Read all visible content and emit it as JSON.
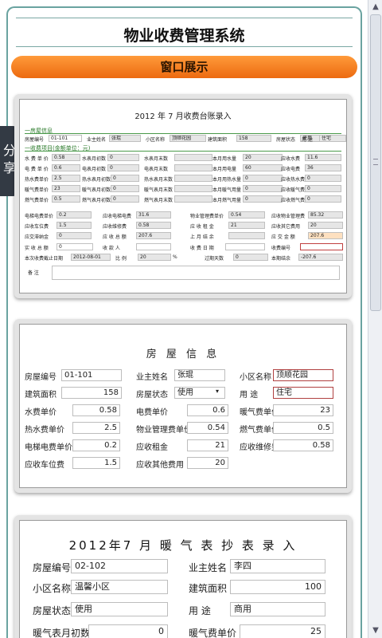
{
  "page_title": "物业收费管理系统",
  "section_bar": "窗口展示",
  "share_label": "分享",
  "card1": {
    "title": "2012  年  7  月收费台账录入",
    "section_house": "一房屋信息",
    "section_fee": "一收费项目(金额单位：元)",
    "house_no_label": "房屋编号",
    "house_no": "01-101",
    "owner_label": "业主姓名",
    "owner": "张琨",
    "area_name_label": "小区名称",
    "area_name": "顶顺花园",
    "building_area_label": "建筑面积",
    "building_area": "158",
    "house_state_label": "房屋状态",
    "house_state": "使用",
    "use_label": "用 途",
    "use": "住宅",
    "water_price_label": "水 费 单 价",
    "water_price": "0.58",
    "water_start_label": "水表月初数",
    "water_start": "0",
    "water_end_label": "水表月末数",
    "water_end": "",
    "water_used_label": "本月用水量",
    "water_used": "20",
    "water_due_label": "应收水费",
    "water_due": "11.6",
    "elec_price_label": "电 费 单 价",
    "elec_price": "0.6",
    "elec_start_label": "电表月初数",
    "elec_start": "0",
    "elec_end_label": "电表月末数",
    "elec_end": "",
    "elec_used_label": "本月用电量",
    "elec_used": "60",
    "elec_due_label": "应收电费",
    "elec_due": "36",
    "hotwater_price_label": "热水费单价",
    "hotwater_price": "2.5",
    "hotwater_start_label": "热水表月初数",
    "hotwater_start": "0",
    "hotwater_end_label": "热水表月末数",
    "hotwater_end": "",
    "hotwater_used_label": "本月用热水量",
    "hotwater_used": "0",
    "hotwater_due_label": "应收热水费",
    "hotwater_due": "0",
    "heat_price_label": "暖气费单价",
    "heat_price": "23",
    "heat_start_label": "暖气表月初数",
    "heat_start": "0",
    "heat_end_label": "暖气表月末数",
    "heat_end": "",
    "heat_used_label": "本月暖气用量",
    "heat_used": "0",
    "heat_due_label": "应收暖气费",
    "heat_due": "0",
    "gas_price_label": "燃气费单价",
    "gas_price": "0.5",
    "gas_start_label": "燃气表月初数",
    "gas_start": "0",
    "gas_end_label": "燃气表月末数",
    "gas_end": "",
    "gas_used_label": "本月燃气用量",
    "gas_used": "0",
    "gas_due_label": "应收燃气费",
    "gas_due": "0",
    "lift_price_label": "电梯电费单价",
    "lift_price": "0.2",
    "lift_due_label": "应收电梯电费",
    "lift_due": "31.6",
    "mgmt_price_label": "物业管理费单价",
    "mgmt_price": "0.54",
    "mgmt_due_label": "应收物业管理费",
    "mgmt_due": "85.32",
    "parking_label": "应收车位费",
    "parking": "1.5",
    "repair_label": "应收维修费",
    "repair": "0.58",
    "rent_label": "应 收 租 金",
    "rent": "21",
    "other_label": "应收其它费用",
    "other": "20",
    "late_label": "应交滞纳金",
    "late": "0",
    "total_label": "应 收 总 额",
    "total": "207.6",
    "last_balance_label": "上 月 结 余",
    "last_balance": "",
    "pay_total_label": "应 交 金 额",
    "pay_total": "207.6",
    "paid_label": "实 收 总 额",
    "paid": "0",
    "payer_label": "收 款 人",
    "payer": "",
    "pay_date_label": "收 费 日 期",
    "pay_date": "",
    "receipt_label": "收费编号",
    "receipt": "",
    "deadline_label": "本次收费截止日期",
    "deadline": "2012-08-01",
    "ratio_label": "比 例",
    "ratio": "20",
    "ratio_unit": "%",
    "overdue_label": "过期天数",
    "overdue": "0",
    "balance_label": "本期结余",
    "balance": "-207.6",
    "note_label": "备   注",
    "note": ""
  },
  "card2": {
    "title": "房 屋 信 息",
    "rows": [
      [
        {
          "label": "房屋编号",
          "value": "01-101",
          "align": "left"
        },
        {
          "label": "业主姓名",
          "value": "张琨",
          "align": "left"
        },
        {
          "label": "小区名称",
          "value": "顶顺花园",
          "align": "left",
          "red": true
        }
      ],
      [
        {
          "label": "建筑面积",
          "value": "158",
          "align": "right"
        },
        {
          "label": "房屋状态",
          "value": "使用",
          "align": "left",
          "dropdown": true
        },
        {
          "label": "用  途",
          "value": "住宅",
          "align": "left",
          "red": true
        }
      ],
      [
        {
          "label": "水费单价",
          "value": "0.58",
          "align": "right"
        },
        {
          "label": "电费单价",
          "value": "0.6",
          "align": "right"
        },
        {
          "label": "暖气费单价",
          "value": "23",
          "align": "right"
        }
      ],
      [
        {
          "label": "热水费单价",
          "value": "2.5",
          "align": "right"
        },
        {
          "label": "物业管理费单价",
          "value": "0.54",
          "align": "right"
        },
        {
          "label": "燃气费单价",
          "value": "0.5",
          "align": "right"
        }
      ],
      [
        {
          "label": "电梯电费单价",
          "value": "0.2",
          "align": "right"
        },
        {
          "label": "应收租金",
          "value": "21",
          "align": "right"
        },
        {
          "label": "应收维修费",
          "value": "0.58",
          "align": "right"
        }
      ],
      [
        {
          "label": "应收车位费",
          "value": "1.5",
          "align": "right"
        },
        {
          "label": "应收其他费用",
          "value": "20",
          "align": "right"
        }
      ]
    ]
  },
  "card3": {
    "title": "2012年7 月 暖 气 表 抄 表 录 入",
    "house_no_label": "房屋编号",
    "house_no": "02-102",
    "owner_label": "业主姓名",
    "owner": "李四",
    "area_name_label": "小区名称",
    "area_name": "温馨小区",
    "building_area_label": "建筑面积",
    "building_area": "100",
    "house_state_label": "房屋状态",
    "house_state": "使用",
    "use_label": "用  途",
    "use": "商用",
    "heat_start_label": "暖气表月初数",
    "heat_start": "0",
    "heat_price_label": "暖气费单价",
    "heat_price": "25"
  }
}
